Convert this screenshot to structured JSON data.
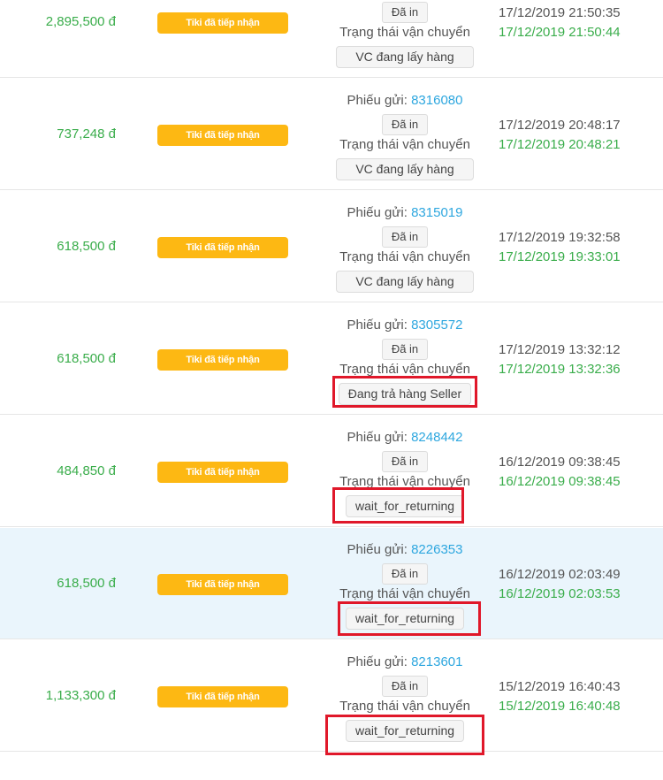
{
  "ship_status_label": "Trạng thái vận chuyển",
  "ship_prefix": "Phiếu gửi:",
  "orders": [
    {
      "amount": "2,895,500 đ",
      "status": "Tiki đã tiếp nhận",
      "ship_no": "",
      "printed": "Đã in",
      "carrier_status": "VC đang lấy hàng",
      "created": "17/12/2019 21:50:35",
      "updated": "17/12/2019 21:50:44"
    },
    {
      "amount": "737,248 đ",
      "status": "Tiki đã tiếp nhận",
      "ship_no": "8316080",
      "printed": "Đã in",
      "carrier_status": "VC đang lấy hàng",
      "created": "17/12/2019 20:48:17",
      "updated": "17/12/2019 20:48:21"
    },
    {
      "amount": "618,500 đ",
      "status": "Tiki đã tiếp nhận",
      "ship_no": "8315019",
      "printed": "Đã in",
      "carrier_status": "VC đang lấy hàng",
      "created": "17/12/2019 19:32:58",
      "updated": "17/12/2019 19:33:01"
    },
    {
      "amount": "618,500 đ",
      "status": "Tiki đã tiếp nhận",
      "ship_no": "8305572",
      "printed": "Đã in",
      "carrier_status": "Đang trả hàng Seller",
      "created": "17/12/2019 13:32:12",
      "updated": "17/12/2019 13:32:36"
    },
    {
      "amount": "484,850 đ",
      "status": "Tiki đã tiếp nhận",
      "ship_no": "8248442",
      "printed": "Đã in",
      "carrier_status": "wait_for_returning",
      "created": "16/12/2019 09:38:45",
      "updated": "16/12/2019 09:38:45"
    },
    {
      "amount": "618,500 đ",
      "status": "Tiki đã tiếp nhận",
      "ship_no": "8226353",
      "printed": "Đã in",
      "carrier_status": "wait_for_returning",
      "created": "16/12/2019 02:03:49",
      "updated": "16/12/2019 02:03:53"
    },
    {
      "amount": "1,133,300 đ",
      "status": "Tiki đã tiếp nhận",
      "ship_no": "8213601",
      "printed": "Đã in",
      "carrier_status": "wait_for_returning",
      "created": "15/12/2019 16:40:43",
      "updated": "15/12/2019 16:40:48"
    }
  ],
  "colors": {
    "accent_green": "#3aad4b",
    "badge_orange": "#fdb813",
    "link_blue": "#2ea7df",
    "annotation_red": "#e0182a",
    "highlight_row": "#eaf5fc"
  }
}
